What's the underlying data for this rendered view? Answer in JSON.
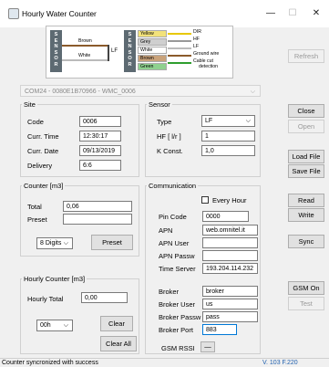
{
  "window": {
    "title": "Hourly Water Counter",
    "minimize": "—",
    "maximize": "☐",
    "close": "✕"
  },
  "diagram": {
    "left_sensor_text": "SENSOR",
    "left_wires": [
      "Brown",
      "White"
    ],
    "lf_label": "LF",
    "right_sensor_text": "SENSOR",
    "right_wires": [
      "Yellow",
      "Grey",
      "White",
      "Brown",
      "Green"
    ],
    "terminals": [
      "DIR",
      "HF",
      "LF",
      "Ground wire",
      "Cable cut",
      "detection"
    ]
  },
  "device_combo": {
    "value": "COM24 - 0080E1B70966 - WMC_0006"
  },
  "site": {
    "label": "Site",
    "code_label": "Code",
    "code_value": "0006",
    "time_label": "Curr. Time",
    "time_value": "12:30:17",
    "date_label": "Curr. Date",
    "date_value": "09/13/2019",
    "delivery_label": "Delivery",
    "delivery_value": "6:6"
  },
  "sensor": {
    "label": "Sensor",
    "type_label": "Type",
    "type_value": "LF",
    "hf_label": "HF [ l/r ]",
    "hf_value": "1",
    "k_label": "K Const.",
    "k_value": "1,0"
  },
  "counter": {
    "label": "Counter [m3]",
    "total_label": "Total",
    "total_value": "0,06",
    "preset_label": "Preset",
    "preset_value": "",
    "digits_value": "8 Digits",
    "preset_button": "Preset"
  },
  "hourly": {
    "label": "Hourly Counter [m3]",
    "total_label": "Hourly Total",
    "total_value": "0,00",
    "hour_value": "00h",
    "clear_button": "Clear",
    "clear_all_button": "Clear All"
  },
  "comm": {
    "label": "Communication",
    "every_hour_label": "Every Hour",
    "pin_label": "Pin Code",
    "pin_value": "0000",
    "apn_label": "APN",
    "apn_value": "web.omnitel.it",
    "apn_user_label": "APN User",
    "apn_user_value": "",
    "apn_pass_label": "APN Passw",
    "apn_pass_value": "",
    "time_server_label": "Time Server",
    "time_server_value": "193.204.114.232",
    "broker_label": "Broker",
    "broker_value": "broker",
    "broker_user_label": "Broker User",
    "broker_user_value": "us",
    "broker_pass_label": "Broker Passw",
    "broker_pass_value": "pass",
    "broker_port_label": "Broker Port",
    "broker_port_value": "883",
    "rssi_label": "GSM RSSI",
    "rssi_value": "—"
  },
  "side_buttons": {
    "refresh": "Refresh",
    "close": "Close",
    "open": "Open",
    "load_file": "Load File",
    "save_file": "Save File",
    "read": "Read",
    "write": "Write",
    "sync": "Sync",
    "gsm_on": "GSM On",
    "test": "Test"
  },
  "status": {
    "message": "Counter syncronized with success",
    "version": "V. 103 F.220"
  },
  "colors": {
    "version_text": "#1f5fae",
    "sensor_box": "#5d6a72",
    "focus_border": "#0078d7"
  }
}
